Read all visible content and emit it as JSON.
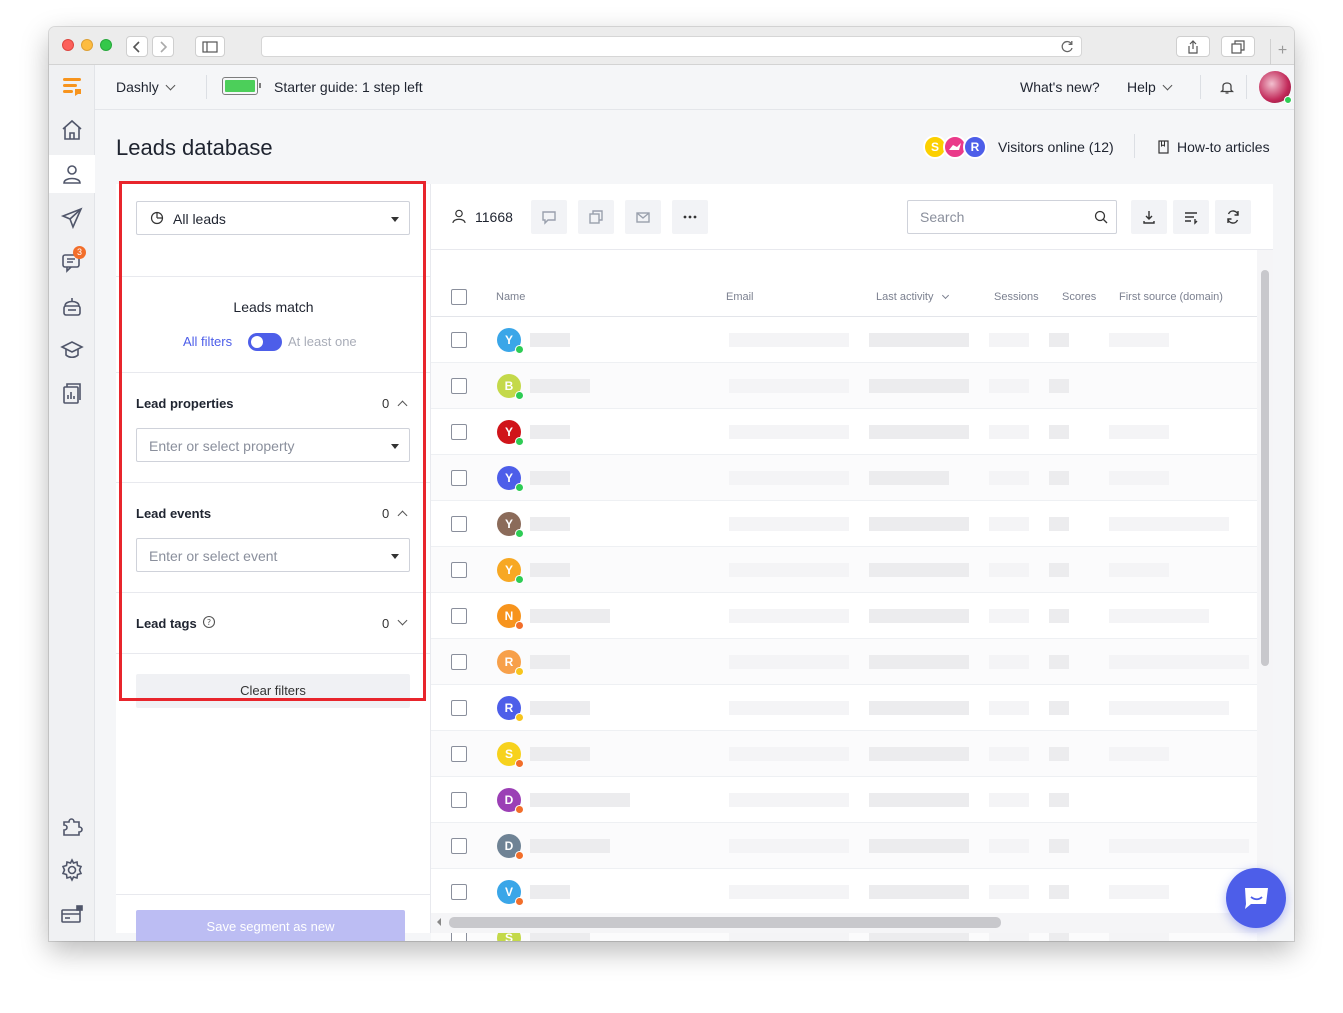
{
  "app": {
    "workspace": "Dashly",
    "starter_guide": "Starter guide: 1 step left",
    "whats_new": "What's new?",
    "help": "Help",
    "notifications_badge": "3",
    "brand_color": "#f7941d",
    "accent_color": "#4d5ee9"
  },
  "page": {
    "title": "Leads database",
    "visitors_online": "Visitors online (12)",
    "visitor_avatars": [
      {
        "letter": "S",
        "color": "#fcd000"
      },
      {
        "letter": "",
        "color": "#ea3a8a"
      },
      {
        "letter": "R",
        "color": "#4d5ee9"
      }
    ],
    "how_to": "How-to articles"
  },
  "filters": {
    "segment": "All leads",
    "leads_match": "Leads match",
    "all_filters": "All filters",
    "at_least_one": "At least one",
    "properties": {
      "title": "Lead properties",
      "count": "0",
      "placeholder": "Enter or select property"
    },
    "events": {
      "title": "Lead events",
      "count": "0",
      "placeholder": "Enter or select event"
    },
    "tags": {
      "title": "Lead tags",
      "count": "0"
    },
    "clear": "Clear filters",
    "save": "Save segment as new"
  },
  "table": {
    "count": "11668",
    "search_placeholder": "Search",
    "columns": {
      "name": "Name",
      "email": "Email",
      "last_activity": "Last activity",
      "sessions": "Sessions",
      "scores": "Scores",
      "source": "First source (domain)"
    },
    "rows": [
      {
        "letter": "Y",
        "color": "#3aa6e8",
        "status": "#2ecc55"
      },
      {
        "letter": "B",
        "color": "#c4d94a",
        "status": "#2ecc55"
      },
      {
        "letter": "Y",
        "color": "#d0141a",
        "status": "#2ecc55"
      },
      {
        "letter": "Y",
        "color": "#4d5ee9",
        "status": "#2ecc55"
      },
      {
        "letter": "Y",
        "color": "#8b6b5a",
        "status": "#2ecc55"
      },
      {
        "letter": "Y",
        "color": "#f7a823",
        "status": "#2ecc55"
      },
      {
        "letter": "N",
        "color": "#f7941d",
        "status": "#f26e2a"
      },
      {
        "letter": "R",
        "color": "#f7a04a",
        "status": "#f7c51d"
      },
      {
        "letter": "R",
        "color": "#4d5ee9",
        "status": "#f7c51d"
      },
      {
        "letter": "S",
        "color": "#f7d21d",
        "status": "#f26e2a"
      },
      {
        "letter": "D",
        "color": "#9b3fb5",
        "status": "#f26e2a"
      },
      {
        "letter": "D",
        "color": "#6f8395",
        "status": "#f26e2a"
      },
      {
        "letter": "V",
        "color": "#3aa6e8",
        "status": "#f26e2a"
      },
      {
        "letter": "S",
        "color": "#c4d94a",
        "status": "#f26e2a"
      }
    ]
  }
}
